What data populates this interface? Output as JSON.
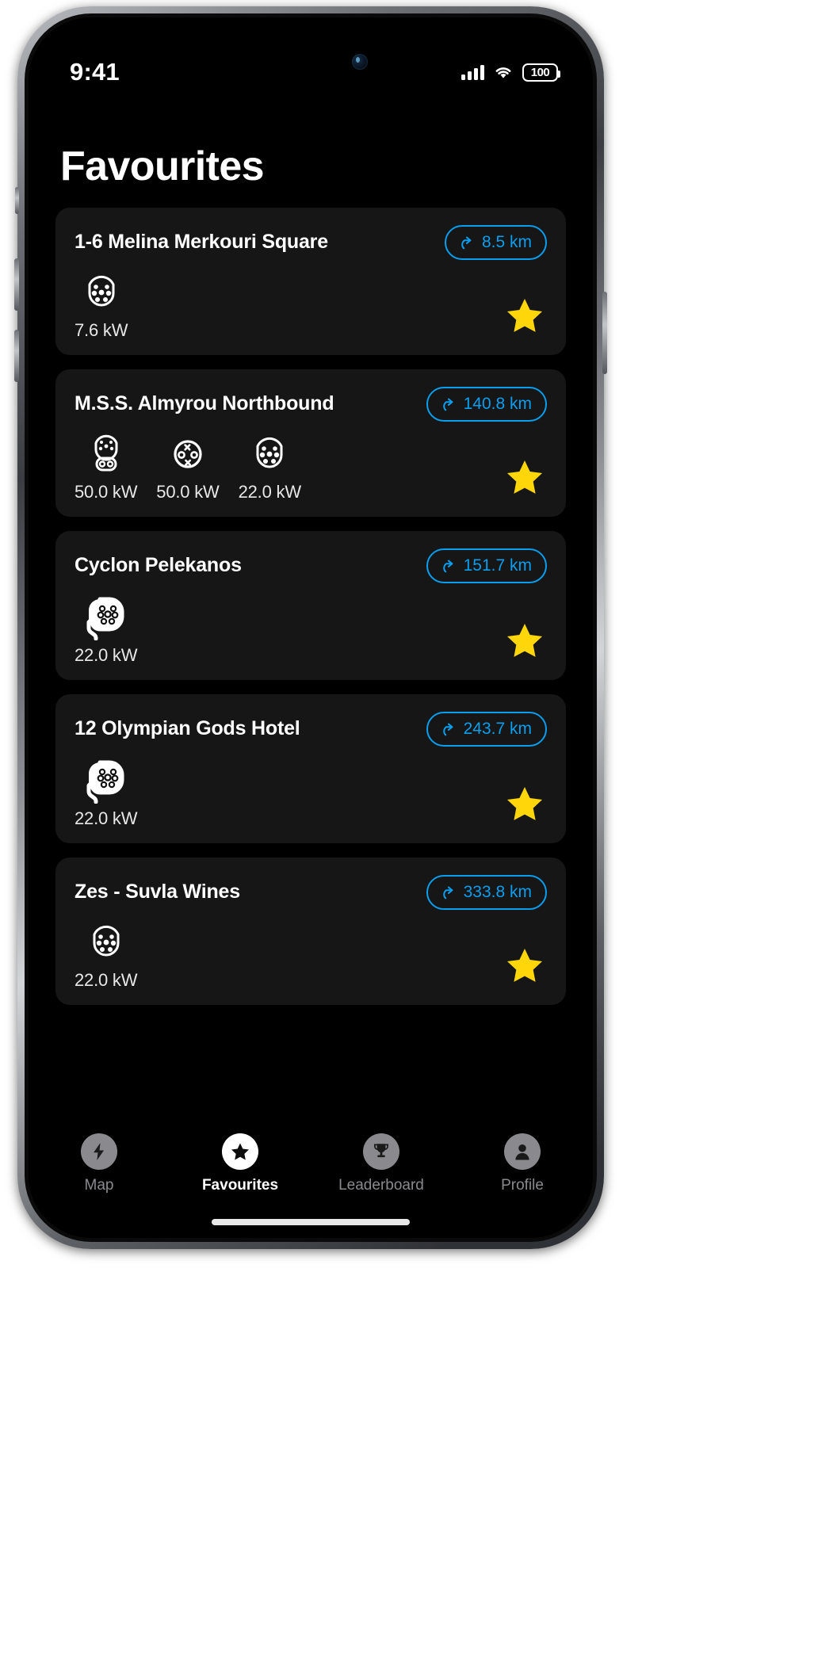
{
  "status_bar": {
    "time": "9:41",
    "battery_level": "100",
    "signal_icon": "cellular-signal-icon",
    "wifi_icon": "wifi-icon",
    "battery_icon": "battery-icon"
  },
  "header": {
    "title": "Favourites"
  },
  "colors": {
    "accent_blue": "#0a9ef0",
    "star_yellow": "#FFD60A",
    "card_background": "#161616",
    "screen_background": "#000000"
  },
  "stations": [
    {
      "name": "1-6 Melina Merkouri Square",
      "distance": "8.5 km",
      "favourite": true,
      "connectors": [
        {
          "type": "type2-socket",
          "power": "7.6 kW"
        }
      ]
    },
    {
      "name": "M.S.S. Almyrou Northbound",
      "distance": "140.8 km",
      "favourite": true,
      "connectors": [
        {
          "type": "ccs-combo-socket",
          "power": "50.0 kW"
        },
        {
          "type": "chademo-socket",
          "power": "50.0 kW"
        },
        {
          "type": "type2-socket",
          "power": "22.0 kW"
        }
      ]
    },
    {
      "name": "Cyclon Pelekanos",
      "distance": "151.7 km",
      "favourite": true,
      "connectors": [
        {
          "type": "type2-tethered-plug",
          "power": "22.0 kW"
        }
      ]
    },
    {
      "name": "12 Olympian Gods Hotel",
      "distance": "243.7 km",
      "favourite": true,
      "connectors": [
        {
          "type": "type2-tethered-plug",
          "power": "22.0 kW"
        }
      ]
    },
    {
      "name": "Zes - Suvla Wines",
      "distance": "333.8 km",
      "favourite": true,
      "connectors": [
        {
          "type": "type2-socket",
          "power": "22.0 kW"
        }
      ]
    }
  ],
  "tabs": [
    {
      "label": "Map",
      "icon": "bolt-icon",
      "active": false
    },
    {
      "label": "Favourites",
      "icon": "star-icon",
      "active": true
    },
    {
      "label": "Leaderboard",
      "icon": "trophy-icon",
      "active": false
    },
    {
      "label": "Profile",
      "icon": "person-icon",
      "active": false
    }
  ]
}
